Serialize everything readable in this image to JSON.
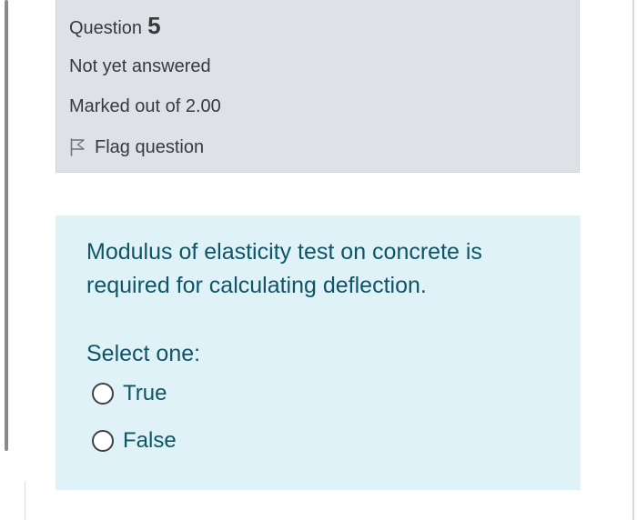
{
  "question_info": {
    "label": "Question",
    "number": "5",
    "status": "Not yet answered",
    "marks": "Marked out of 2.00",
    "flag_label": "Flag question",
    "flag_icon": "flag-outline-icon"
  },
  "question": {
    "text": "Modulus of elasticity test on concrete is required for calculating deflection.",
    "prompt": "Select one:",
    "options": [
      {
        "label": "True",
        "selected": false
      },
      {
        "label": "False",
        "selected": false
      }
    ]
  },
  "colors": {
    "info_background": "#dee2e6",
    "form_background": "#def2f8",
    "question_text": "#0f5566",
    "info_text": "#373a3c"
  }
}
